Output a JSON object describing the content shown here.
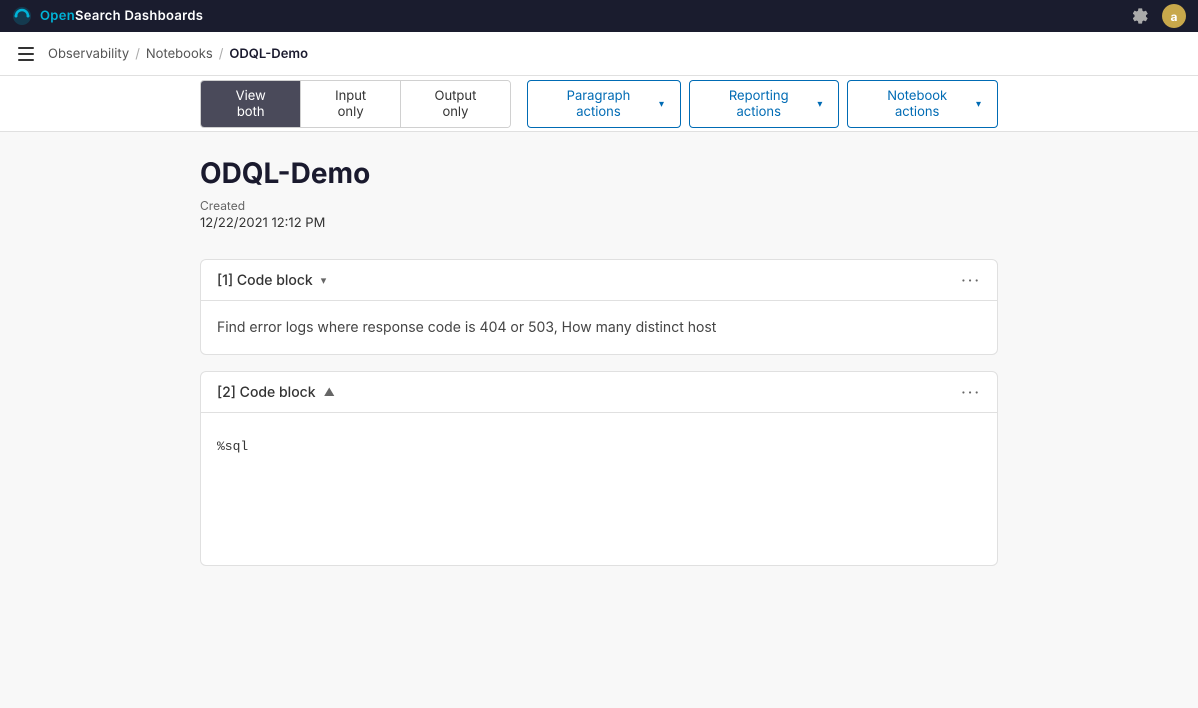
{
  "topbar": {
    "logo_open": "Open",
    "logo_rest": "Search Dashboards",
    "avatar_label": "a"
  },
  "secondbar": {
    "breadcrumb_observability": "Observability",
    "breadcrumb_notebooks": "Notebooks",
    "breadcrumb_current": "ODQL-Demo",
    "sep": "/"
  },
  "toolbar": {
    "view_both_label": "View both",
    "input_only_label": "Input only",
    "output_only_label": "Output only",
    "paragraph_actions_label": "Paragraph actions",
    "reporting_actions_label": "Reporting actions",
    "notebook_actions_label": "Notebook actions"
  },
  "notebook": {
    "title": "ODQL-Demo",
    "meta_label": "Created",
    "meta_date": "12/22/2021 12:12 PM",
    "blocks": [
      {
        "id": "[1] Code block",
        "collapse_icon": "▾",
        "content_text": "Find error logs where response code is 404 or 503, How many distinct host",
        "is_code": false
      },
      {
        "id": "[2] Code block",
        "collapse_icon": "▲",
        "content_code": "%sql",
        "is_code": true
      }
    ]
  },
  "icons": {
    "hamburger": "≡",
    "settings": "⚙",
    "chevron_down": "▾",
    "menu_dots": "···"
  }
}
